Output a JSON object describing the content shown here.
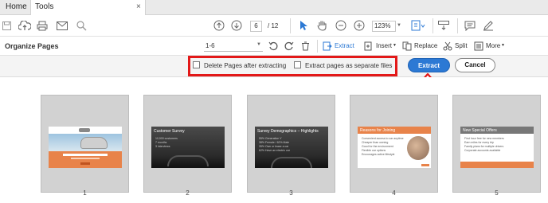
{
  "tabs": [
    {
      "label": "Home"
    },
    {
      "label": "Tools"
    }
  ],
  "tab_close": "×",
  "toolbar": {
    "current_page": "6",
    "page_total": "/ 12",
    "zoom": "123%"
  },
  "organize": {
    "title": "Organize Pages",
    "range": "1-6",
    "extract_label": "Extract",
    "insert_label": "Insert",
    "replace_label": "Replace",
    "split_label": "Split",
    "more_label": "More"
  },
  "options": {
    "delete_label": "Delete Pages after extracting",
    "separate_label": "Extract pages as separate files",
    "extract_button": "Extract",
    "cancel_button": "Cancel"
  },
  "pages": [
    {
      "number": "1"
    },
    {
      "number": "2",
      "title": "Customer Survey",
      "bullets": [
        "10,000 customers",
        "7 months",
        "3 interviews"
      ]
    },
    {
      "number": "3",
      "title": "Survey Demographics – Highlights",
      "bullets": [
        "55% Generation Y",
        "38% Female / 62% Male",
        "35% Own or lease a car",
        "62% Have an electric car"
      ]
    },
    {
      "number": "4",
      "title": "Reasons for Joining",
      "bullets": [
        "Convenient access to car anytime",
        "Cheaper than owning",
        "Good for the environment",
        "Flexible car options",
        "Encourages active lifestyle"
      ]
    },
    {
      "number": "5",
      "title": "New Special Offers",
      "bullets": [
        "First hour free for new members",
        "Earn miles for every trip",
        "Family plans for multiple drivers",
        "Corporate accounts available"
      ]
    }
  ],
  "colors": {
    "accent_blue": "#2c79d4",
    "highlight_red": "#e31818",
    "slide_orange": "#e8834a"
  }
}
